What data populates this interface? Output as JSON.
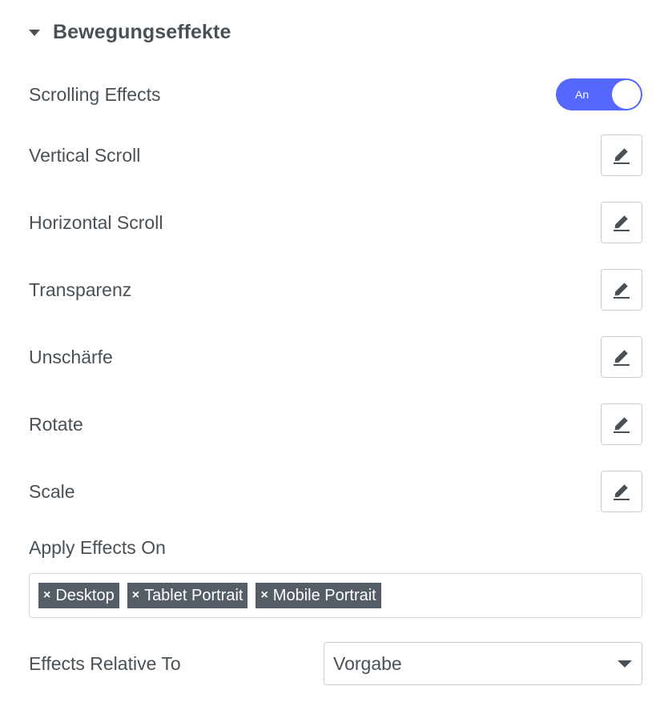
{
  "section": {
    "title": "Bewegungseffekte",
    "icon": "caret-down-icon"
  },
  "scrolling_effects": {
    "label": "Scrolling Effects",
    "toggle_text": "An",
    "enabled": true,
    "accent_color": "#5468ff"
  },
  "effects": [
    {
      "label": "Vertical Scroll",
      "icon": "pencil-icon"
    },
    {
      "label": "Horizontal Scroll",
      "icon": "pencil-icon"
    },
    {
      "label": "Transparenz",
      "icon": "pencil-icon"
    },
    {
      "label": "Unschärfe",
      "icon": "pencil-icon"
    },
    {
      "label": "Rotate",
      "icon": "pencil-icon"
    },
    {
      "label": "Scale",
      "icon": "pencil-icon"
    }
  ],
  "apply_effects": {
    "label": "Apply Effects On",
    "remove_symbol": "×",
    "tags": [
      "Desktop",
      "Tablet Portrait",
      "Mobile Portrait"
    ]
  },
  "relative_to": {
    "label": "Effects Relative To",
    "value": "Vorgabe"
  }
}
